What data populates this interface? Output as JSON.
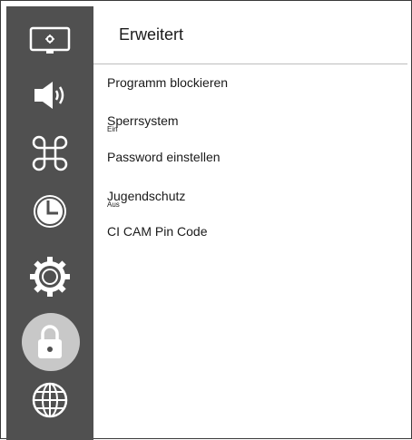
{
  "header": {
    "title": "Erweitert"
  },
  "sidebar": {
    "items": [
      {
        "name": "display",
        "icon": "monitor-icon"
      },
      {
        "name": "sound",
        "icon": "speaker-icon"
      },
      {
        "name": "command",
        "icon": "command-key-icon"
      },
      {
        "name": "timer",
        "icon": "clock-icon"
      },
      {
        "name": "settings",
        "icon": "gear-icon"
      },
      {
        "name": "lock",
        "icon": "lock-icon",
        "active": true
      },
      {
        "name": "network",
        "icon": "globe-icon"
      }
    ]
  },
  "menu": {
    "items": [
      {
        "label": "Programm blockieren",
        "sub": ""
      },
      {
        "label": "Sperrsystem",
        "sub": "Ein"
      },
      {
        "label": "Password einstellen",
        "sub": ""
      },
      {
        "label": "Jugendschutz",
        "sub": "Aus"
      },
      {
        "label": "CI CAM Pin Code",
        "sub": ""
      }
    ]
  },
  "colors": {
    "sidebar": "#505050",
    "active_bubble": "#c8c8c8",
    "icon": "#ffffff"
  }
}
